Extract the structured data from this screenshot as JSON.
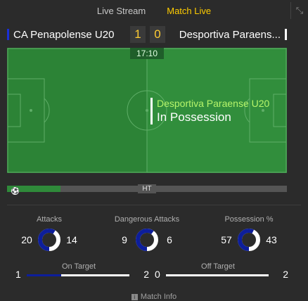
{
  "tabs": [
    {
      "label": "Live Stream",
      "active": false
    },
    {
      "label": "Match Live",
      "active": true
    }
  ],
  "icons": {
    "collapse": "collapse-arrows-icon",
    "ball": "football-icon",
    "info": "info-icon"
  },
  "match": {
    "home_team": "CA Penapolense U20",
    "away_team": "Desportiva Paraens...",
    "home_score": "1",
    "away_score": "0",
    "clock": "17:10",
    "home_color": "#1a2fd6",
    "away_color": "#ffffff"
  },
  "possession": {
    "team": "Desportiva Paraense U20",
    "status": "In Possession"
  },
  "timeline": {
    "progress": 0.19,
    "marker": "HT"
  },
  "stats": [
    {
      "label": "Attacks",
      "home": 20,
      "away": 14
    },
    {
      "label": "Dangerous Attacks",
      "home": 9,
      "away": 6
    },
    {
      "label": "Possession %",
      "home": 57,
      "away": 43
    }
  ],
  "bar_stats": [
    {
      "label": "On Target",
      "home": 1,
      "away": 2
    },
    {
      "label": "Off Target",
      "home": 0,
      "away": 2
    }
  ],
  "footer": {
    "match_info": "Match Info"
  },
  "colors": {
    "accent": "#ffcc00",
    "pitch": "#2f8a3a",
    "home_ring": "#0d1e9b",
    "away_ring": "#ffffff"
  }
}
